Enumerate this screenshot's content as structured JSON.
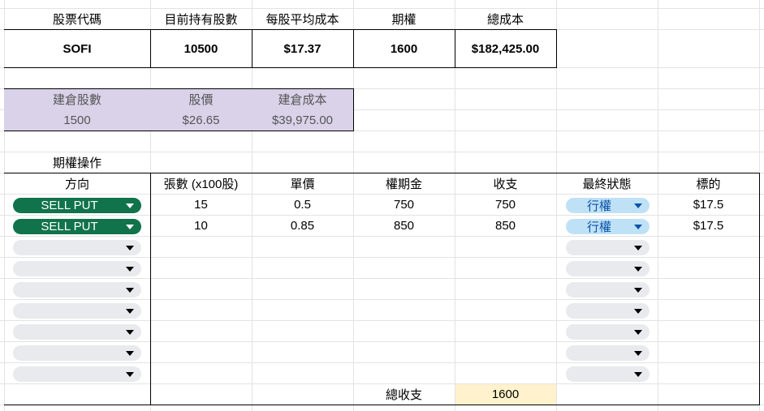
{
  "summary": {
    "headers": [
      "股票代碼",
      "目前持有股數",
      "每股平均成本",
      "期權",
      "總成本"
    ],
    "values": [
      "SOFI",
      "10500",
      "$17.37",
      "1600",
      "$182,425.00"
    ]
  },
  "position": {
    "headers": [
      "建倉股數",
      "股價",
      "建倉成本"
    ],
    "values": [
      "1500",
      "$26.65",
      "$39,975.00"
    ],
    "fill_color": "#d9d2e9"
  },
  "options": {
    "section_title": "期權操作",
    "headers": [
      "方向",
      "張數 (x100股)",
      "單價",
      "權期金",
      "收支",
      "最終狀態",
      "標的"
    ],
    "rows": [
      {
        "direction": "SELL PUT",
        "contracts": "15",
        "price": "0.5",
        "premium": "750",
        "cashflow": "750",
        "status": "行權",
        "underlying": "$17.5"
      },
      {
        "direction": "SELL PUT",
        "contracts": "10",
        "price": "0.85",
        "premium": "850",
        "cashflow": "850",
        "status": "行權",
        "underlying": "$17.5"
      }
    ],
    "empty_dropdown_rows": 7,
    "total_label": "總收支",
    "total_value": "1600",
    "total_fill_color": "#fff2cc"
  },
  "colors": {
    "gridline": "#e2e3e3",
    "sell_put_chip": "#11734b",
    "status_chip": "#bfe1f6",
    "status_chip_text": "#0a53a8",
    "empty_chip": "#e8eaed"
  },
  "icons": {
    "dropdown": "triangle-down-icon"
  }
}
